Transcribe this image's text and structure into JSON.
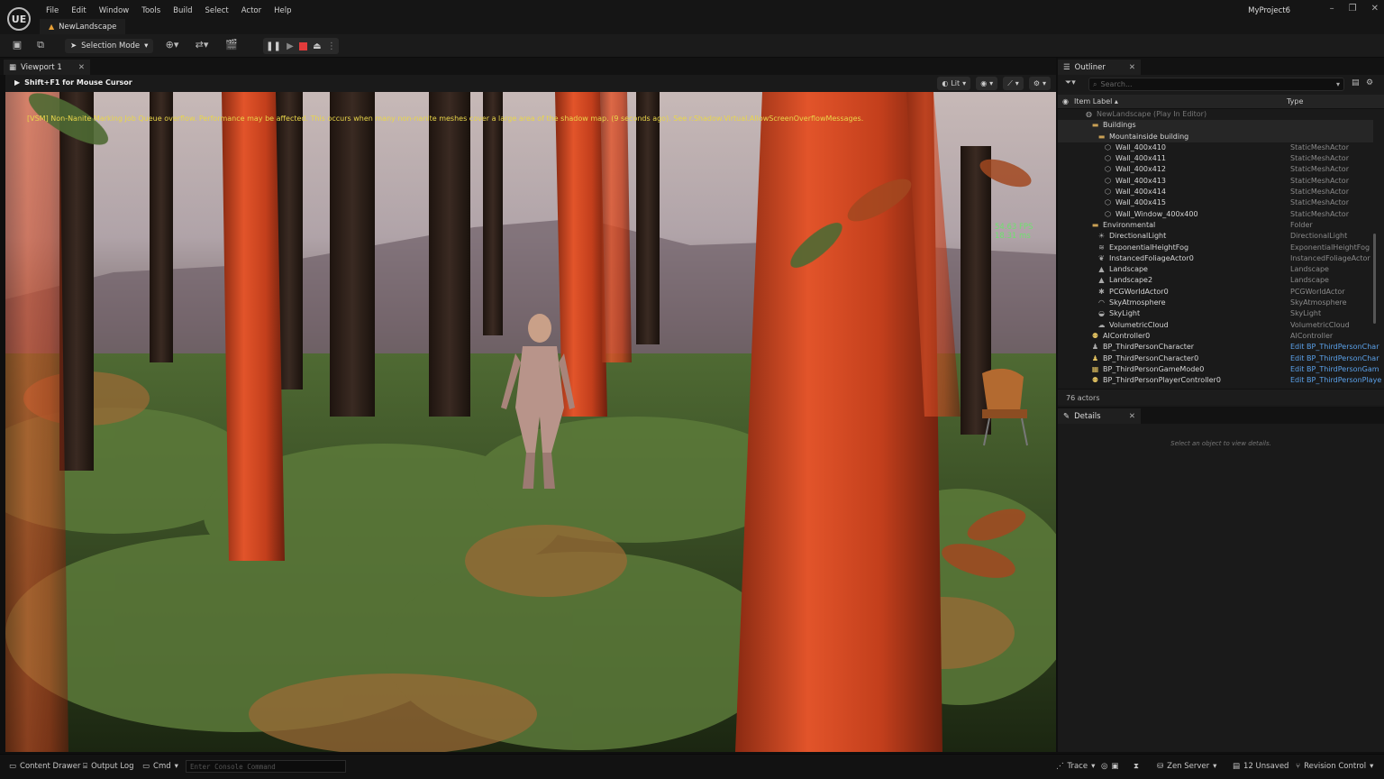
{
  "app": {
    "logo_text": "UE",
    "menu": [
      "File",
      "Edit",
      "Window",
      "Tools",
      "Build",
      "Select",
      "Actor",
      "Help"
    ],
    "level_tab": "NewLandscape",
    "project_name": "MyProject6",
    "window_controls": [
      "–",
      "❐",
      "✕"
    ]
  },
  "toolbar": {
    "selection_mode": "Selection Mode"
  },
  "viewport": {
    "tab_label": "Viewport 1",
    "hint": "Shift+F1 for Mouse Cursor",
    "view_mode": "Lit",
    "warning": "[VSM] Non-Nanite Marking Job Queue overflow. Performance may be affected. This occurs when many non-nanite meshes cover a large area of the shadow map. (9 seconds ago). See r.Shadow.Virtual.AllowScreenOverflowMessages.",
    "fps": "54.63 FPS",
    "frame_ms": "18.31 ms"
  },
  "outliner": {
    "tab_label": "Outliner",
    "search_placeholder": "Search...",
    "col_label": "Item Label",
    "col_type": "Type",
    "rows": [
      {
        "label": "NewLandscape (Play In Editor)",
        "type": "",
        "indent": 0,
        "icon": "world-icon",
        "grey": true
      },
      {
        "label": "Buildings",
        "type": "",
        "indent": 1,
        "icon": "folder-icon",
        "folder": true
      },
      {
        "label": "Mountainside building",
        "type": "",
        "indent": 2,
        "icon": "folder-icon",
        "folder": true
      },
      {
        "label": "Wall_400x410",
        "type": "StaticMeshActor",
        "indent": 3,
        "icon": "mesh-icon"
      },
      {
        "label": "Wall_400x411",
        "type": "StaticMeshActor",
        "indent": 3,
        "icon": "mesh-icon"
      },
      {
        "label": "Wall_400x412",
        "type": "StaticMeshActor",
        "indent": 3,
        "icon": "mesh-icon"
      },
      {
        "label": "Wall_400x413",
        "type": "StaticMeshActor",
        "indent": 3,
        "icon": "mesh-icon"
      },
      {
        "label": "Wall_400x414",
        "type": "StaticMeshActor",
        "indent": 3,
        "icon": "mesh-icon"
      },
      {
        "label": "Wall_400x415",
        "type": "StaticMeshActor",
        "indent": 3,
        "icon": "mesh-icon"
      },
      {
        "label": "Wall_Window_400x400",
        "type": "StaticMeshActor",
        "indent": 3,
        "icon": "mesh-icon"
      },
      {
        "label": "Environmental",
        "type": "Folder",
        "indent": 1,
        "icon": "folder-icon"
      },
      {
        "label": "DirectionalLight",
        "type": "DirectionalLight",
        "indent": 2,
        "icon": "light-icon"
      },
      {
        "label": "ExponentialHeightFog",
        "type": "ExponentialHeightFog",
        "indent": 2,
        "icon": "fog-icon"
      },
      {
        "label": "InstancedFoliageActor0",
        "type": "InstancedFoliageActor",
        "indent": 2,
        "icon": "foliage-icon"
      },
      {
        "label": "Landscape",
        "type": "Landscape",
        "indent": 2,
        "icon": "landscape-icon"
      },
      {
        "label": "Landscape2",
        "type": "Landscape",
        "indent": 2,
        "icon": "landscape-icon"
      },
      {
        "label": "PCGWorldActor0",
        "type": "PCGWorldActor",
        "indent": 2,
        "icon": "pcg-icon"
      },
      {
        "label": "SkyAtmosphere",
        "type": "SkyAtmosphere",
        "indent": 2,
        "icon": "sky-icon"
      },
      {
        "label": "SkyLight",
        "type": "SkyLight",
        "indent": 2,
        "icon": "skylight-icon"
      },
      {
        "label": "VolumetricCloud",
        "type": "VolumetricCloud",
        "indent": 2,
        "icon": "cloud-icon"
      },
      {
        "label": "AIController0",
        "type": "AIController",
        "indent": 1,
        "icon": "controller-icon",
        "yellow": true
      },
      {
        "label": "BP_ThirdPersonCharacter",
        "type": "Edit BP_ThirdPersonChar",
        "indent": 1,
        "icon": "pawn-icon",
        "link": true
      },
      {
        "label": "BP_ThirdPersonCharacter0",
        "type": "Edit BP_ThirdPersonChar",
        "indent": 1,
        "icon": "pawn-icon",
        "link": true,
        "yellow": true
      },
      {
        "label": "BP_ThirdPersonGameMode0",
        "type": "Edit BP_ThirdPersonGam",
        "indent": 1,
        "icon": "gamemode-icon",
        "link": true,
        "yellow": true
      },
      {
        "label": "BP_ThirdPersonPlayerController0",
        "type": "Edit BP_ThirdPersonPlaye",
        "indent": 1,
        "icon": "controller-icon",
        "link": true,
        "yellow": true
      }
    ],
    "actor_count": "76 actors"
  },
  "details": {
    "tab_label": "Details",
    "empty_text": "Select an object to view details."
  },
  "statusbar": {
    "content_drawer": "Content Drawer",
    "output_log": "Output Log",
    "cmd": "Cmd",
    "console_placeholder": "Enter Console Command",
    "trace": "Trace",
    "zen": "Zen Server",
    "unsaved": "12 Unsaved",
    "revision": "Revision Control"
  }
}
